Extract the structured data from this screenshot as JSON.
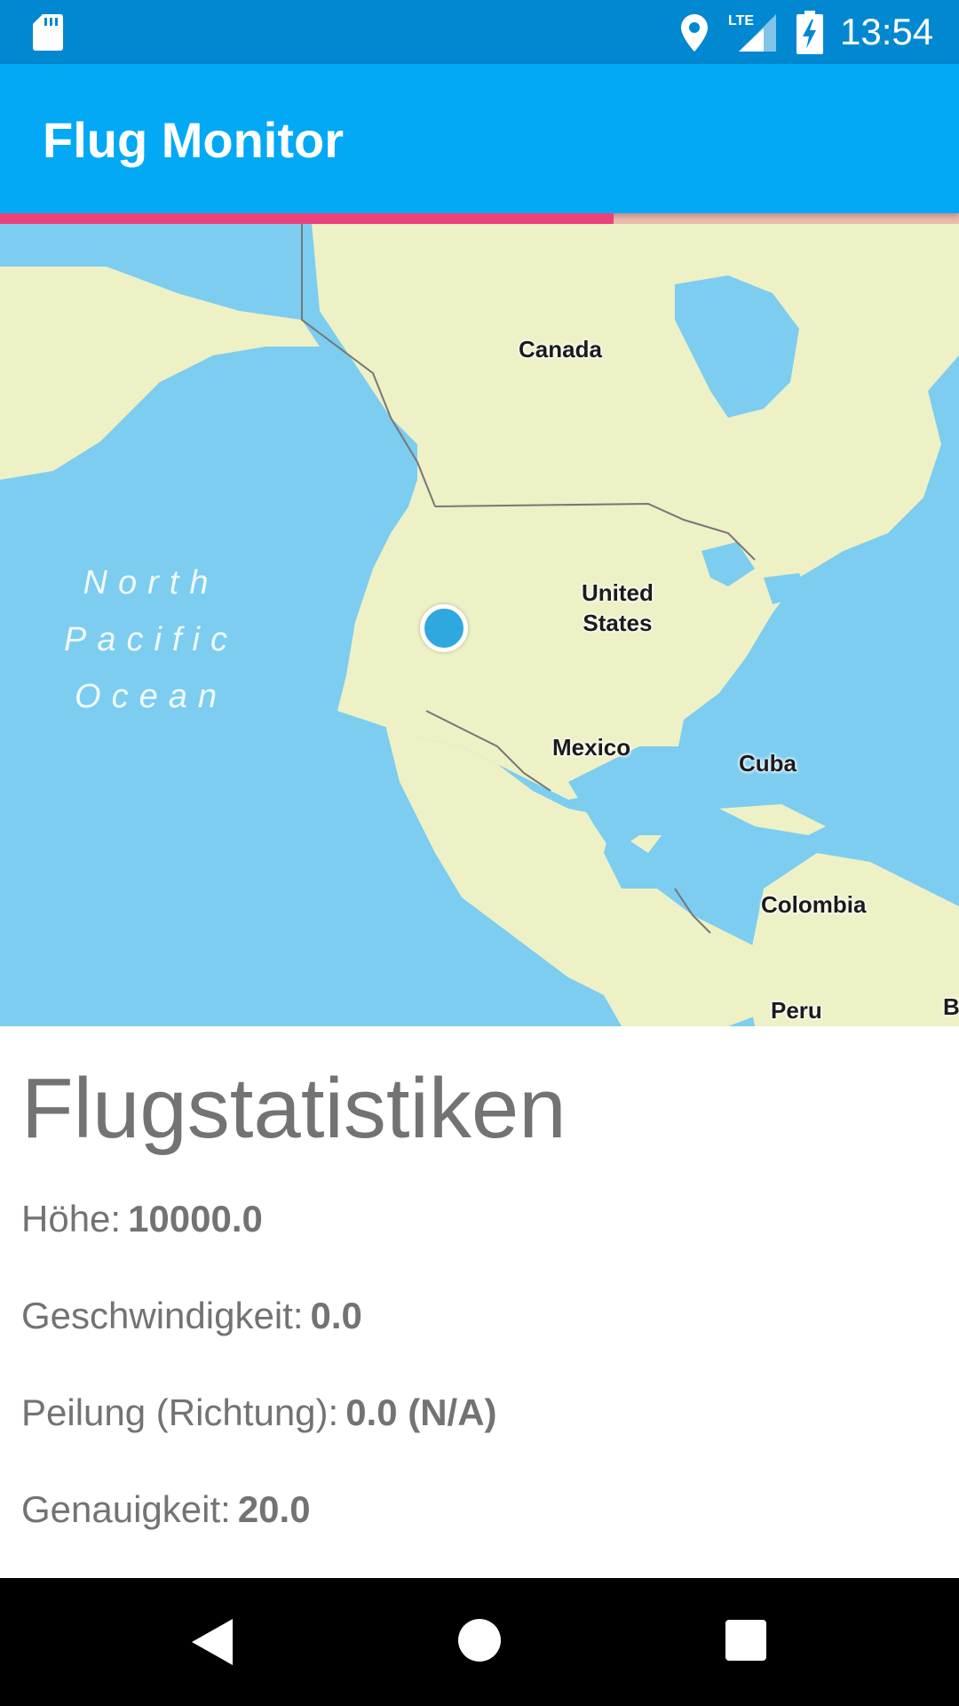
{
  "status_bar": {
    "time": "13:54",
    "network": "LTE",
    "icons": [
      "sd-card-icon",
      "location-icon",
      "lte-signal-icon",
      "battery-charging-icon"
    ]
  },
  "app_bar": {
    "title": "Flug Monitor",
    "color": "#03a9f4"
  },
  "progress": {
    "fraction": 0.64,
    "color": "#ec407a"
  },
  "map": {
    "labels": {
      "canada": "Canada",
      "united_states": "United\nStates",
      "mexico": "Mexico",
      "cuba": "Cuba",
      "colombia": "Colombia",
      "peru": "Peru",
      "edge": "B"
    },
    "ocean_label": [
      "North",
      "Pacific",
      "Ocean"
    ],
    "water_color": "#7ccdf0",
    "land_color": "#eef0c6",
    "marker_color": "#2fa8e0"
  },
  "stats": {
    "title": "Flugstatistiken",
    "rows": [
      {
        "label": "Höhe:",
        "value": "10000.0"
      },
      {
        "label": "Geschwindigkeit:",
        "value": "0.0"
      },
      {
        "label": "Peilung (Richtung):",
        "value": "0.0 (N/A)"
      },
      {
        "label": "Genauigkeit:",
        "value": "20.0"
      }
    ]
  },
  "nav_bar": {
    "buttons": [
      "back-icon",
      "home-icon",
      "recent-apps-icon"
    ]
  }
}
